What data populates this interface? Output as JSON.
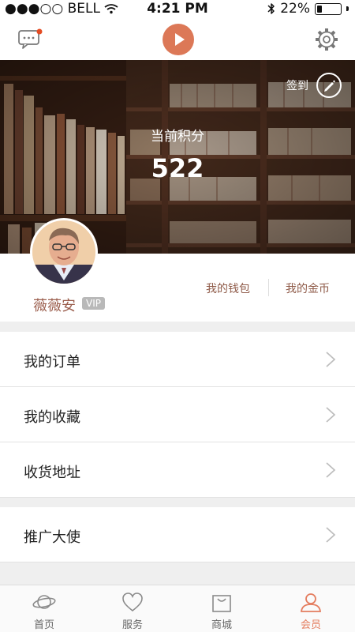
{
  "status": {
    "carrier": "●●●○○ BELL",
    "time": "4:21 PM",
    "battery_percent": "22%",
    "battery_level": 0.22
  },
  "profile": {
    "points_label": "当前积分",
    "points_value": "522",
    "checkin_label": "签到",
    "user_name": "薇薇安",
    "vip_label": "VIP",
    "wallet_label": "我的钱包",
    "gold_label": "我的金币"
  },
  "menu": [
    {
      "label": "我的订单"
    },
    {
      "label": "我的收藏"
    },
    {
      "label": "收货地址"
    },
    {
      "label": "推广大使"
    }
  ],
  "tabs": [
    {
      "label": "首页",
      "icon": "planet-icon"
    },
    {
      "label": "服务",
      "icon": "heart-icon"
    },
    {
      "label": "商城",
      "icon": "shopping-bag-icon"
    },
    {
      "label": "会员",
      "icon": "user-icon"
    }
  ],
  "colors": {
    "accent": "#e47d5f",
    "brown": "#8f5b49",
    "play_button": "#dc7857"
  }
}
